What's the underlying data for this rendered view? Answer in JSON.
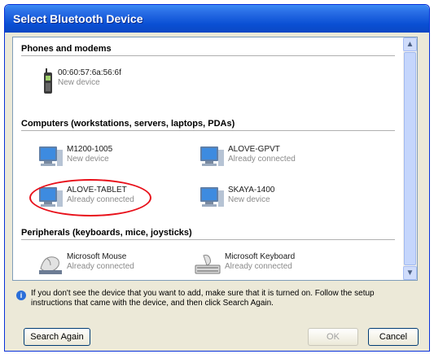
{
  "window": {
    "title": "Select Bluetooth Device"
  },
  "groups": [
    {
      "header": "Phones and modems",
      "devices": [
        {
          "name": "00:60:57:6a:56:6f",
          "status": "New device",
          "icon": "phone-icon"
        }
      ]
    },
    {
      "header": "Computers (workstations, servers, laptops, PDAs)",
      "devices": [
        {
          "name": "M1200-1005",
          "status": "New device",
          "icon": "computer-icon"
        },
        {
          "name": "ALOVE-GPVT",
          "status": "Already connected",
          "icon": "computer-icon"
        },
        {
          "name": "ALOVE-TABLET",
          "status": "Already connected",
          "icon": "computer-icon"
        },
        {
          "name": "SKAYA-1400",
          "status": "New device",
          "icon": "computer-icon"
        }
      ]
    },
    {
      "header": "Peripherals (keyboards, mice, joysticks)",
      "devices": [
        {
          "name": "Microsoft Mouse",
          "status": "Already connected",
          "icon": "mouse-icon"
        },
        {
          "name": "Microsoft Keyboard",
          "status": "Already connected",
          "icon": "keyboard-icon"
        }
      ]
    }
  ],
  "info_text": "If you don't see the device that you want to add, make sure that it is turned on. Follow the setup instructions that came with the device, and then click Search Again.",
  "buttons": {
    "search_again": "Search Again",
    "ok": "OK",
    "cancel": "Cancel"
  },
  "colors": {
    "title_bar": "#0a4fd4",
    "highlight": "#e8101a"
  }
}
